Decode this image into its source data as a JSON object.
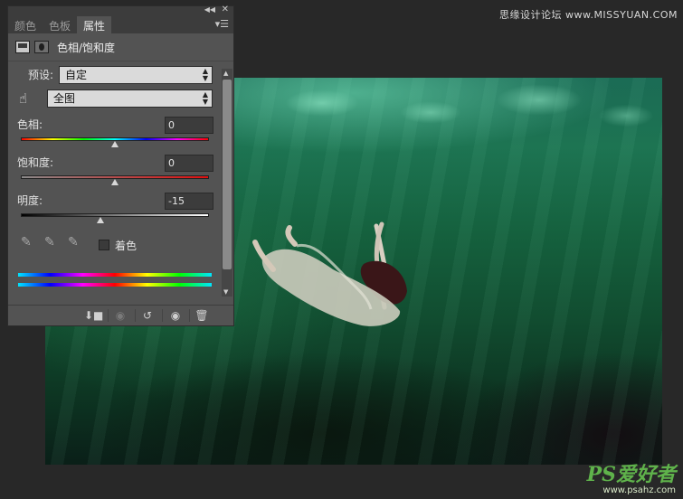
{
  "watermark": {
    "top_right": "思缘设计论坛 www.MISSYUAN.COM",
    "logo": "PS爱好者",
    "url": "www.psahz.com"
  },
  "panel": {
    "tabs": [
      {
        "label": "颜色",
        "active": false
      },
      {
        "label": "色板",
        "active": false
      },
      {
        "label": "属性",
        "active": true
      }
    ],
    "title": "色相/饱和度",
    "preset": {
      "label": "预设:",
      "value": "自定"
    },
    "channel": {
      "value": "全图"
    },
    "hue": {
      "label": "色相:",
      "value": "0",
      "slider_fraction": 0.5
    },
    "saturation": {
      "label": "饱和度:",
      "value": "0",
      "slider_fraction": 0.5
    },
    "lightness": {
      "label": "明度:",
      "value": "-15",
      "slider_fraction": 0.425
    },
    "colorize": {
      "label": "着色",
      "checked": false
    }
  },
  "icons": {
    "collapse": "double-arrow-collapse-icon",
    "close": "close-icon",
    "menu": "panel-menu-icon",
    "layer": "adjustment-layer-icon",
    "mask": "mask-icon",
    "hand": "targeted-adjustment-hand-icon",
    "eyedroppers": [
      "eyedropper-icon",
      "eyedropper-plus-icon",
      "eyedropper-minus-icon"
    ],
    "footer": [
      "clip-to-layer-icon",
      "view-previous-state-icon",
      "reset-icon",
      "visibility-eye-icon",
      "trash-icon"
    ]
  },
  "colors": {
    "panel_bg": "#535353",
    "water_green": "#1d7452"
  }
}
